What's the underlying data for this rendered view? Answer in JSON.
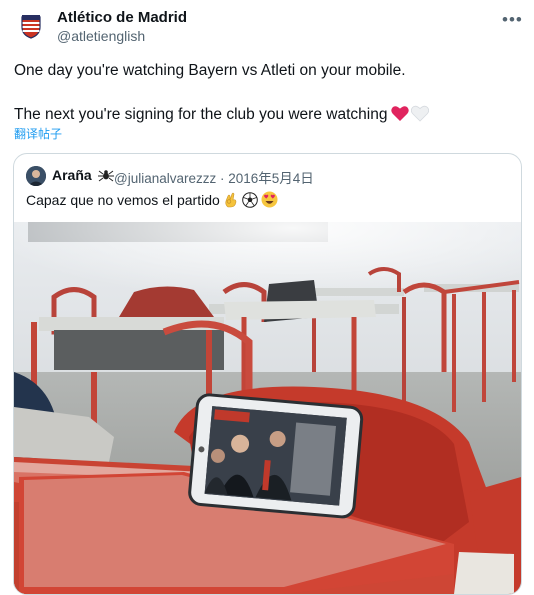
{
  "tweet": {
    "author_name": "Atlético de Madrid",
    "author_handle": "@atletienglish",
    "line1": "One day you're watching Bayern vs Atleti on your mobile.",
    "line2": "The next you're signing for the club you were watching",
    "translate_label": "翻译帖子",
    "icons": {
      "more": "more-options-icon",
      "hearts": [
        "red-heart-icon",
        "white-heart-icon"
      ],
      "avatar": "atletico-crest-icon"
    }
  },
  "quote": {
    "author_name": "Araña",
    "author_handle": "@julianalvarezzz",
    "date": "· 2016年5月4日",
    "text": "Capaz que no vemos el partido",
    "icons": [
      "spider-icon",
      "ok-hand-icon",
      "soccer-ball-icon",
      "heart-eyes-icon"
    ],
    "image": "classroom-phone-photo"
  },
  "colors": {
    "accent": "#1d9bf0",
    "text": "#0f1419",
    "muted": "#536471",
    "heart_red": "#e0245e",
    "desk_red": "#c43b2c"
  }
}
